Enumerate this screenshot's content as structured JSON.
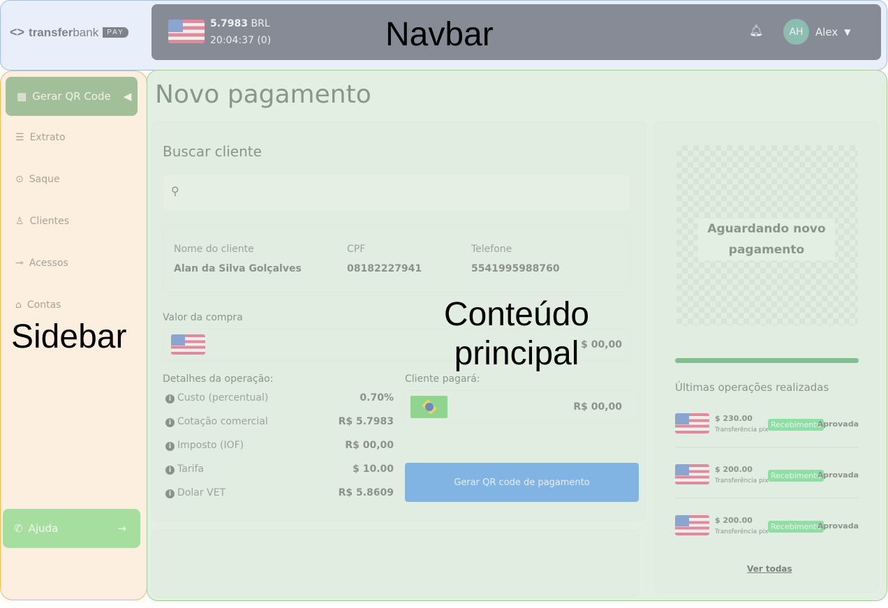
{
  "overlay_labels": {
    "navbar": "Navbar",
    "sidebar": "Sidebar",
    "main": "Conteúdo principal"
  },
  "brand": {
    "name_bold": "transfer",
    "name_light": "bank",
    "badge": "PAY"
  },
  "navbar": {
    "rate": "5.7983",
    "currency": "BRL",
    "time": "20:04:37 (0)",
    "avatar": "AH",
    "user": "Alex"
  },
  "sidebar": {
    "items": [
      {
        "label": "Gerar QR Code",
        "icon": "qr-icon"
      },
      {
        "label": "Extrato",
        "icon": "list-icon"
      },
      {
        "label": "Saque",
        "icon": "withdraw-icon"
      },
      {
        "label": "Clientes",
        "icon": "user-icon"
      },
      {
        "label": "Acessos",
        "icon": "key-icon"
      },
      {
        "label": "Contas",
        "icon": "bank-icon"
      }
    ],
    "help": "Ajuda"
  },
  "main": {
    "title": "Novo pagamento",
    "search_title": "Buscar cliente",
    "search_placeholder": "",
    "client": {
      "name_label": "Nome do cliente",
      "name": "Alan da Silva Golçalves",
      "cpf_label": "CPF",
      "cpf": "08182227941",
      "phone_label": "Telefone",
      "phone": "5541995988760"
    },
    "purchase_label": "Valor da compra",
    "purchase_value": "$ 00,00",
    "details_label": "Detalhes da operação:",
    "details": [
      {
        "label": "Custo (percentual)",
        "value": "0.70%"
      },
      {
        "label": "Cotação comercial",
        "value": "R$ 5.7983"
      },
      {
        "label": "Imposto (IOF)",
        "value": "R$ 00,00"
      },
      {
        "label": "Tarifa",
        "value": "$ 10.00"
      },
      {
        "label": "Dolar VET",
        "value": "R$ 5.8609"
      }
    ],
    "client_pays_label": "Cliente pagará:",
    "client_pays_value": "R$ 00,00",
    "generate_button": "Gerar QR code de pagamento"
  },
  "qr_panel": {
    "waiting": "Aguardando novo pagamento",
    "progress": 1.0,
    "recent_title": "Últimas operações realizadas",
    "operations": [
      {
        "amount": "$ 230.00",
        "type": "Transferência pix",
        "badge": "Recebimento",
        "status": "Aprovada"
      },
      {
        "amount": "$ 200.00",
        "type": "Transferência pix",
        "badge": "Recebimento",
        "status": "Aprovada"
      },
      {
        "amount": "$ 200.00",
        "type": "Transferência pix",
        "badge": "Recebimento",
        "status": "Aprovada"
      }
    ],
    "see_all": "Ver todas"
  },
  "colors": {
    "accent": "#a1c09a",
    "button": "#82b4e3",
    "help": "#a6dea0"
  }
}
